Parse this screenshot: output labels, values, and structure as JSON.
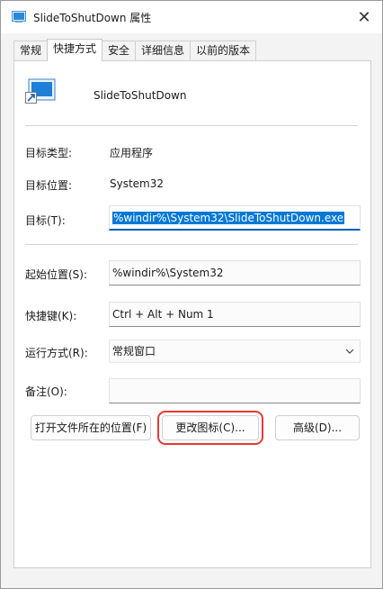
{
  "window": {
    "title": "SlideToShutDown 属性",
    "close_glyph": "✕"
  },
  "tabs": [
    {
      "label": "常规",
      "active": false
    },
    {
      "label": "快捷方式",
      "active": true
    },
    {
      "label": "安全",
      "active": false
    },
    {
      "label": "详细信息",
      "active": false
    },
    {
      "label": "以前的版本",
      "active": false
    }
  ],
  "shortcut": {
    "name": "SlideToShutDown",
    "target_type_label": "目标类型:",
    "target_type_value": "应用程序",
    "target_location_label": "目标位置:",
    "target_location_value": "System32",
    "target_label": "目标(T):",
    "target_value": "%windir%\\System32\\SlideToShutDown.exe",
    "start_in_label": "起始位置(S):",
    "start_in_value": "%windir%\\System32",
    "hotkey_label": "快捷键(K):",
    "hotkey_value": "Ctrl + Alt + Num 1",
    "run_label": "运行方式(R):",
    "run_value": "常规窗口",
    "comment_label": "备注(O):",
    "comment_value": ""
  },
  "buttons": {
    "open_location": "打开文件所在的位置(F)",
    "change_icon": "更改图标(C)...",
    "advanced": "高级(D)..."
  },
  "colors": {
    "selection": "#0078d4",
    "highlight_box": "#e53935",
    "focus_underline": "#005fb8"
  },
  "icons": {
    "app": "shortcut-app-icon",
    "close": "close-icon",
    "dropdown": "chevron-down-icon"
  }
}
